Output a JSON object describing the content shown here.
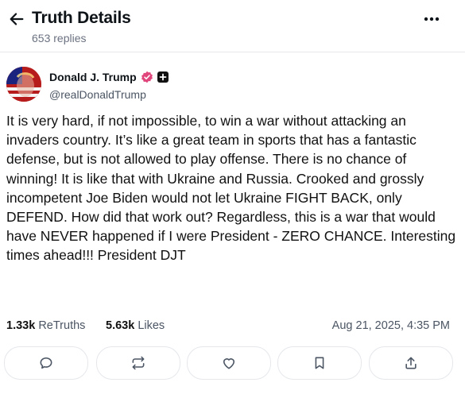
{
  "header": {
    "title": "Truth Details",
    "subtitle": "653 replies"
  },
  "post": {
    "author_name": "Donald J. Trump",
    "author_handle": "@realDonaldTrump",
    "text": "It is very hard, if not impossible, to win a war without attacking an invaders country. It’s like a great team in sports that has a fantastic defense, but is not allowed to play offense. There is no chance of winning! It is like that with Ukraine and Russia. Crooked and grossly incompetent Joe Biden would not let Ukraine FIGHT BACK, only DEFEND. How did that work out? Regardless, this is a war that would have NEVER happened if I were President - ZERO CHANCE. Interesting times ahead!!! President DJT",
    "retruths_count": "1.33k",
    "retruths_label": "ReTruths",
    "likes_count": "5.63k",
    "likes_label": "Likes",
    "timestamp": "Aug 21, 2025, 4:35 PM"
  },
  "icons": {
    "back": "arrow-left-icon",
    "more": "more-horizontal-icon",
    "verified": "verified-badge-icon",
    "plus": "plus-badge-icon",
    "reply": "comment-icon",
    "retruth": "repost-icon",
    "like": "heart-icon",
    "bookmark": "bookmark-icon",
    "share": "share-icon"
  },
  "colors": {
    "verified": "#e0457b",
    "text": "#0f1419",
    "muted": "#6b7280"
  }
}
